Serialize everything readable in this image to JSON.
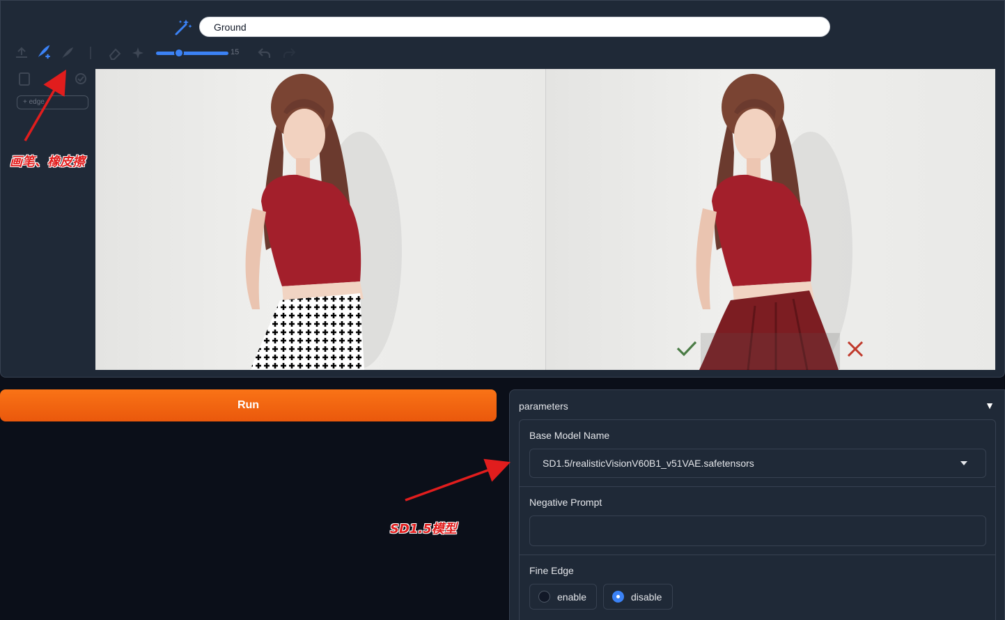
{
  "prompt": {
    "value": "Ground"
  },
  "toolbar": {
    "brush_size": "15",
    "edge_tag": "+ edge"
  },
  "annotations": {
    "brush_eraser": "画笔、橡皮擦",
    "sd15_model": "SD1.5模型"
  },
  "run": {
    "label": "Run"
  },
  "parameters": {
    "title": "parameters",
    "toggle_icon": "▼",
    "base_model": {
      "label": "Base Model Name",
      "value": "SD1.5/realisticVisionV60B1_v51VAE.safetensors"
    },
    "negative_prompt": {
      "label": "Negative Prompt",
      "value": ""
    },
    "fine_edge": {
      "label": "Fine Edge",
      "options": [
        "enable",
        "disable"
      ],
      "selected": "disable"
    }
  },
  "colors": {
    "accent": "#f97316",
    "panel": "#1f2937",
    "background": "#0b0f19",
    "annotation": "#e11d1d",
    "selected_radio": "#3b82f6"
  }
}
